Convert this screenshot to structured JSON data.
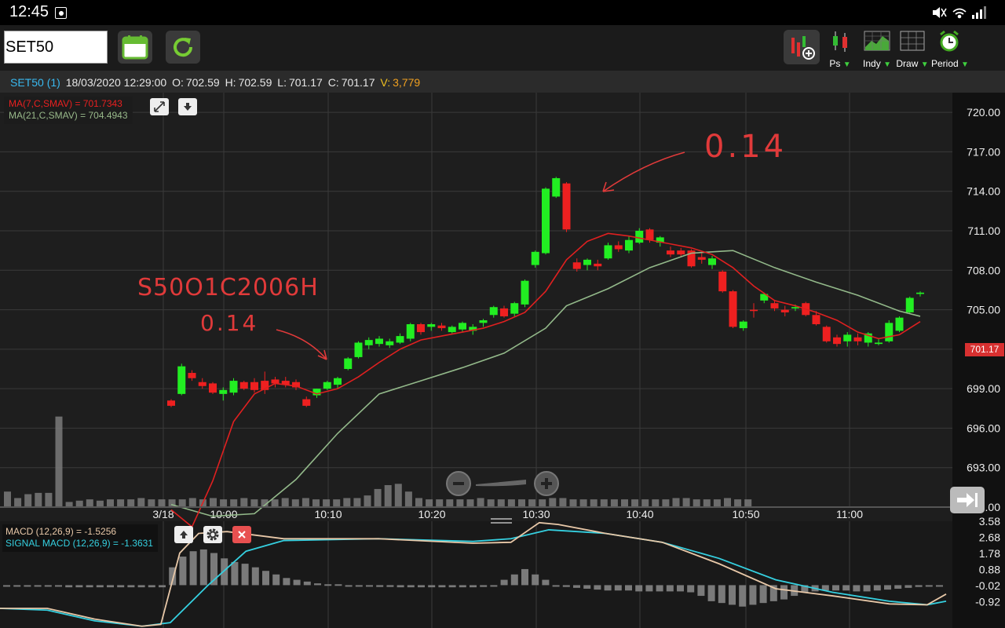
{
  "statusbar": {
    "time": "12:45",
    "icons": [
      "notification-icon",
      "mute-icon",
      "wifi-icon",
      "signal-icon"
    ]
  },
  "toolbar": {
    "symbol": "SET50",
    "tools": [
      {
        "label": "Ps",
        "icon": "candlestick-icon"
      },
      {
        "label": "Indy",
        "icon": "indicator-icon"
      },
      {
        "label": "Draw",
        "icon": "grid-draw-icon"
      },
      {
        "label": "Period",
        "icon": "alarm-clock-icon"
      }
    ],
    "dropdown_glyph": "▼"
  },
  "ohlc": {
    "symbol": "SET50 (1)",
    "datetime": "18/03/2020 12:29:00",
    "o_label": "O:",
    "o": "702.59",
    "h_label": "H:",
    "h": "702.59",
    "l_label": "L:",
    "l": "701.17",
    "c_label": "C:",
    "c": "701.17",
    "v_label": "V:",
    "v": "3,779"
  },
  "legends": {
    "ma7": "MA(7,C,SMAV) = 701.7343",
    "ma21": "MA(21,C,SMAV) = 704.4943",
    "macd": "MACD (12,26,9) = -1.5256",
    "signal": "SIGNAL MACD (12,26,9) = -1.3631"
  },
  "last_price": "701.17",
  "annotations": {
    "top_right": "0.14",
    "left_code": "S50O1C2006H",
    "left_value": "0.14"
  },
  "colors": {
    "up": "#22ee22",
    "down": "#ee2020",
    "ma7": "#e02020",
    "ma21": "#93b98a",
    "macd": "#e8c8a8",
    "signal": "#35d0e0",
    "grid": "#3a3a3a",
    "volume": "#808080"
  },
  "chart_data": [
    {
      "type": "candlestick",
      "title": "",
      "ylim": [
        690,
        721.5
      ],
      "yticks": [
        "720.00",
        "717.00",
        "714.00",
        "711.00",
        "708.00",
        "705.00",
        "702.00",
        "699.00",
        "696.00",
        "693.00",
        "690.00"
      ],
      "xticks": [
        "3/18",
        "10:00",
        "10:10",
        "10:20",
        "10:30",
        "10:40",
        "10:50",
        "11:00"
      ],
      "grid": true,
      "candles": [
        {
          "o": 698.1,
          "h": 698.2,
          "l": 697.6,
          "c": 697.7
        },
        {
          "o": 698.6,
          "h": 700.9,
          "l": 698.5,
          "c": 700.7
        },
        {
          "o": 700.2,
          "h": 700.4,
          "l": 699.6,
          "c": 699.8
        },
        {
          "o": 699.5,
          "h": 699.8,
          "l": 699.0,
          "c": 699.2
        },
        {
          "o": 699.4,
          "h": 699.5,
          "l": 698.6,
          "c": 698.7
        },
        {
          "o": 698.6,
          "h": 699.1,
          "l": 698.1,
          "c": 698.9
        },
        {
          "o": 698.7,
          "h": 699.8,
          "l": 698.5,
          "c": 699.6
        },
        {
          "o": 699.5,
          "h": 699.6,
          "l": 698.9,
          "c": 699.0
        },
        {
          "o": 699.5,
          "h": 699.8,
          "l": 698.7,
          "c": 698.9
        },
        {
          "o": 699.6,
          "h": 700.3,
          "l": 698.6,
          "c": 698.9
        },
        {
          "o": 699.7,
          "h": 699.9,
          "l": 699.1,
          "c": 699.4
        },
        {
          "o": 699.6,
          "h": 699.9,
          "l": 699.1,
          "c": 699.3
        },
        {
          "o": 699.5,
          "h": 699.7,
          "l": 698.9,
          "c": 699.1
        },
        {
          "o": 698.2,
          "h": 698.4,
          "l": 697.6,
          "c": 697.7
        },
        {
          "o": 698.5,
          "h": 699.0,
          "l": 698.3,
          "c": 699.0
        },
        {
          "o": 699.0,
          "h": 699.6,
          "l": 698.9,
          "c": 699.5
        },
        {
          "o": 699.3,
          "h": 699.9,
          "l": 699.0,
          "c": 699.8
        },
        {
          "o": 700.5,
          "h": 701.4,
          "l": 700.4,
          "c": 701.3
        },
        {
          "o": 701.4,
          "h": 702.6,
          "l": 701.3,
          "c": 702.5
        },
        {
          "o": 702.3,
          "h": 702.9,
          "l": 702.0,
          "c": 702.7
        },
        {
          "o": 702.4,
          "h": 703.0,
          "l": 702.2,
          "c": 702.8
        },
        {
          "o": 702.3,
          "h": 702.8,
          "l": 702.1,
          "c": 702.6
        },
        {
          "o": 702.5,
          "h": 703.2,
          "l": 702.4,
          "c": 703.0
        },
        {
          "o": 702.8,
          "h": 704.0,
          "l": 702.6,
          "c": 703.9
        },
        {
          "o": 703.9,
          "h": 704.0,
          "l": 703.1,
          "c": 703.3
        },
        {
          "o": 703.7,
          "h": 704.0,
          "l": 703.4,
          "c": 703.9
        },
        {
          "o": 703.8,
          "h": 704.0,
          "l": 703.4,
          "c": 703.6
        },
        {
          "o": 703.3,
          "h": 703.8,
          "l": 703.2,
          "c": 703.7
        },
        {
          "o": 703.5,
          "h": 704.1,
          "l": 703.3,
          "c": 704.0
        },
        {
          "o": 703.4,
          "h": 703.9,
          "l": 703.1,
          "c": 703.7
        },
        {
          "o": 704.0,
          "h": 704.3,
          "l": 703.7,
          "c": 704.2
        },
        {
          "o": 704.6,
          "h": 705.3,
          "l": 704.4,
          "c": 705.2
        },
        {
          "o": 705.1,
          "h": 705.3,
          "l": 704.4,
          "c": 704.5
        },
        {
          "o": 704.7,
          "h": 705.6,
          "l": 704.5,
          "c": 705.5
        },
        {
          "o": 705.4,
          "h": 707.3,
          "l": 705.2,
          "c": 707.2
        },
        {
          "o": 708.4,
          "h": 709.5,
          "l": 708.2,
          "c": 709.4
        },
        {
          "o": 709.3,
          "h": 714.3,
          "l": 709.2,
          "c": 714.2
        },
        {
          "o": 713.6,
          "h": 715.1,
          "l": 713.5,
          "c": 715.0
        },
        {
          "o": 714.6,
          "h": 714.7,
          "l": 710.9,
          "c": 711.1
        },
        {
          "o": 708.6,
          "h": 708.9,
          "l": 707.9,
          "c": 708.1
        },
        {
          "o": 708.4,
          "h": 708.9,
          "l": 708.0,
          "c": 708.8
        },
        {
          "o": 708.5,
          "h": 708.8,
          "l": 708.0,
          "c": 708.3
        },
        {
          "o": 708.9,
          "h": 710.1,
          "l": 708.8,
          "c": 709.9
        },
        {
          "o": 709.9,
          "h": 710.2,
          "l": 709.4,
          "c": 709.6
        },
        {
          "o": 709.5,
          "h": 710.6,
          "l": 709.3,
          "c": 710.3
        },
        {
          "o": 710.1,
          "h": 711.2,
          "l": 710.0,
          "c": 711.0
        },
        {
          "o": 711.1,
          "h": 711.2,
          "l": 710.1,
          "c": 710.3
        },
        {
          "o": 710.1,
          "h": 710.6,
          "l": 709.8,
          "c": 710.5
        },
        {
          "o": 709.5,
          "h": 709.8,
          "l": 709.0,
          "c": 709.2
        },
        {
          "o": 709.5,
          "h": 709.7,
          "l": 709.0,
          "c": 709.2
        },
        {
          "o": 709.5,
          "h": 709.6,
          "l": 708.2,
          "c": 708.3
        },
        {
          "o": 709.0,
          "h": 709.3,
          "l": 708.5,
          "c": 708.8
        },
        {
          "o": 708.4,
          "h": 709.1,
          "l": 708.1,
          "c": 708.9
        },
        {
          "o": 707.9,
          "h": 708.0,
          "l": 706.3,
          "c": 706.4
        },
        {
          "o": 706.4,
          "h": 706.5,
          "l": 703.6,
          "c": 703.7
        },
        {
          "o": 703.6,
          "h": 704.2,
          "l": 703.4,
          "c": 704.1
        },
        {
          "o": 705.0,
          "h": 705.5,
          "l": 704.4,
          "c": 704.9
        },
        {
          "o": 705.7,
          "h": 706.3,
          "l": 705.5,
          "c": 706.2
        },
        {
          "o": 705.5,
          "h": 705.7,
          "l": 704.9,
          "c": 705.1
        },
        {
          "o": 705.0,
          "h": 705.3,
          "l": 704.5,
          "c": 704.8
        },
        {
          "o": 705.1,
          "h": 705.4,
          "l": 704.9,
          "c": 705.2
        },
        {
          "o": 705.5,
          "h": 705.6,
          "l": 704.5,
          "c": 704.6
        },
        {
          "o": 704.6,
          "h": 704.9,
          "l": 703.8,
          "c": 703.9
        },
        {
          "o": 703.7,
          "h": 703.8,
          "l": 702.5,
          "c": 702.6
        },
        {
          "o": 702.9,
          "h": 703.1,
          "l": 702.2,
          "c": 702.4
        },
        {
          "o": 702.6,
          "h": 703.3,
          "l": 702.2,
          "c": 703.1
        },
        {
          "o": 702.9,
          "h": 703.2,
          "l": 702.3,
          "c": 702.6
        },
        {
          "o": 702.5,
          "h": 703.3,
          "l": 702.2,
          "c": 703.2
        },
        {
          "o": 702.4,
          "h": 702.8,
          "l": 702.3,
          "c": 702.5
        },
        {
          "o": 702.6,
          "h": 704.2,
          "l": 702.5,
          "c": 704.0
        },
        {
          "o": 703.4,
          "h": 704.5,
          "l": 703.3,
          "c": 704.4
        },
        {
          "o": 704.8,
          "h": 706.0,
          "l": 704.7,
          "c": 705.9
        },
        {
          "o": 706.2,
          "h": 706.4,
          "l": 706.0,
          "c": 706.3
        }
      ],
      "ma7_points": [
        [
          0,
          689.8
        ],
        [
          2,
          688.5
        ],
        [
          4,
          692.0
        ],
        [
          6,
          696.5
        ],
        [
          8,
          698.6
        ],
        [
          10,
          699.4
        ],
        [
          12,
          699.2
        ],
        [
          14,
          698.6
        ],
        [
          16,
          699.0
        ],
        [
          18,
          699.9
        ],
        [
          20,
          701.0
        ],
        [
          22,
          702.0
        ],
        [
          24,
          702.7
        ],
        [
          26,
          703.0
        ],
        [
          28,
          703.3
        ],
        [
          30,
          703.6
        ],
        [
          32,
          704.1
        ],
        [
          34,
          704.8
        ],
        [
          36,
          706.4
        ],
        [
          38,
          708.8
        ],
        [
          40,
          710.2
        ],
        [
          42,
          710.8
        ],
        [
          44,
          710.6
        ],
        [
          46,
          710.3
        ],
        [
          48,
          710.0
        ],
        [
          50,
          709.7
        ],
        [
          52,
          709.2
        ],
        [
          54,
          708.2
        ],
        [
          56,
          706.8
        ],
        [
          58,
          705.7
        ],
        [
          60,
          705.3
        ],
        [
          62,
          704.8
        ],
        [
          64,
          704.2
        ],
        [
          66,
          703.3
        ],
        [
          68,
          702.8
        ],
        [
          70,
          703.1
        ],
        [
          72,
          704.1
        ]
      ],
      "ma21_points": [
        [
          0,
          690.2
        ],
        [
          4,
          689.3
        ],
        [
          8,
          689.5
        ],
        [
          12,
          692.1
        ],
        [
          16,
          695.6
        ],
        [
          20,
          698.6
        ],
        [
          24,
          699.6
        ],
        [
          28,
          700.6
        ],
        [
          32,
          701.7
        ],
        [
          36,
          703.6
        ],
        [
          38,
          705.3
        ],
        [
          42,
          706.6
        ],
        [
          46,
          708.2
        ],
        [
          50,
          709.3
        ],
        [
          54,
          709.5
        ],
        [
          58,
          708.2
        ],
        [
          62,
          707.1
        ],
        [
          66,
          706.1
        ],
        [
          70,
          704.9
        ],
        [
          72,
          704.5
        ]
      ],
      "volume": {
        "ylim": [
          0,
          3.58
        ],
        "values": [
          0.6,
          0.35,
          0.5,
          0.55,
          0.55,
          3.5,
          0.2,
          0.25,
          0.3,
          0.25,
          0.3,
          0.3,
          0.3,
          0.35,
          0.3,
          0.3,
          0.3,
          0.3,
          0.35,
          0.3,
          0.35,
          0.3,
          0.3,
          0.35,
          0.3,
          0.3,
          0.3,
          0.35,
          0.3,
          0.35,
          0.3,
          0.3,
          0.3,
          0.35,
          0.35,
          0.45,
          0.7,
          0.85,
          0.9,
          0.6,
          0.35,
          0.3,
          0.3,
          0.3,
          0.3,
          0.3,
          0.35,
          0.3,
          0.3,
          0.3,
          0.3,
          0.3,
          0.3,
          0.35,
          0.35,
          0.3,
          0.3,
          0.3,
          0.3,
          0.3,
          0.3,
          0.3,
          0.3,
          0.3,
          0.3,
          0.35,
          0.35,
          0.3,
          0.3,
          0.3,
          0.35,
          0.3,
          0.3
        ]
      }
    },
    {
      "type": "macd",
      "title": "",
      "ylim": [
        -2.4,
        3.58
      ],
      "yticks": [
        "3.58",
        "2.68",
        "1.78",
        "0.88",
        "-0.02",
        "-0.92"
      ],
      "histogram": [
        -0.05,
        -0.05,
        -0.05,
        -0.05,
        -0.05,
        -0.05,
        -0.12,
        -0.12,
        -0.12,
        -0.12,
        -0.12,
        -0.12,
        -0.12,
        -0.12,
        -0.12,
        -0.12,
        1.0,
        1.6,
        1.9,
        2.0,
        1.8,
        1.5,
        1.3,
        1.2,
        1.0,
        0.8,
        0.6,
        0.4,
        0.3,
        0.2,
        0.1,
        0.05,
        0.05,
        0.0,
        -0.05,
        -0.05,
        -0.1,
        -0.1,
        -0.12,
        -0.12,
        -0.12,
        -0.12,
        -0.12,
        -0.12,
        -0.12,
        -0.12,
        -0.1,
        -0.05,
        0.3,
        0.6,
        0.9,
        0.6,
        0.3,
        -0.05,
        -0.1,
        -0.15,
        -0.2,
        -0.25,
        -0.3,
        -0.3,
        -0.3,
        -0.35,
        -0.35,
        -0.35,
        -0.35,
        -0.35,
        -0.4,
        -0.6,
        -0.9,
        -1.0,
        -1.1,
        -1.2,
        -1.1,
        -1.0,
        -0.9,
        -0.8,
        -0.6,
        -0.4,
        -0.35,
        -0.3,
        -0.3,
        -0.3,
        -0.35,
        -0.35,
        -0.3,
        -0.25,
        -0.2,
        -0.15,
        -0.1,
        -0.05,
        0.0
      ],
      "macd_line": [
        [
          0,
          -1.3
        ],
        [
          5,
          -1.3
        ],
        [
          10,
          -1.9
        ],
        [
          15,
          -2.3
        ],
        [
          17,
          -2.2
        ],
        [
          19,
          1.8
        ],
        [
          21,
          2.9
        ],
        [
          24,
          3.0
        ],
        [
          30,
          2.6
        ],
        [
          40,
          2.6
        ],
        [
          50,
          2.35
        ],
        [
          54,
          2.4
        ],
        [
          57,
          3.5
        ],
        [
          59,
          3.4
        ],
        [
          64,
          2.9
        ],
        [
          70,
          2.4
        ],
        [
          76,
          1.2
        ],
        [
          82,
          -0.2
        ],
        [
          88,
          -0.6
        ],
        [
          94,
          -1.05
        ],
        [
          98,
          -1.1
        ],
        [
          100,
          -0.5
        ]
      ],
      "signal_line": [
        [
          0,
          -1.3
        ],
        [
          5,
          -1.4
        ],
        [
          10,
          -2.0
        ],
        [
          15,
          -2.3
        ],
        [
          18,
          -2.1
        ],
        [
          22,
          0.0
        ],
        [
          26,
          1.9
        ],
        [
          30,
          2.5
        ],
        [
          40,
          2.6
        ],
        [
          50,
          2.45
        ],
        [
          54,
          2.6
        ],
        [
          58,
          3.1
        ],
        [
          64,
          2.9
        ],
        [
          70,
          2.4
        ],
        [
          76,
          1.5
        ],
        [
          82,
          0.3
        ],
        [
          88,
          -0.4
        ],
        [
          94,
          -0.9
        ],
        [
          98,
          -1.1
        ],
        [
          100,
          -0.9
        ]
      ]
    }
  ]
}
